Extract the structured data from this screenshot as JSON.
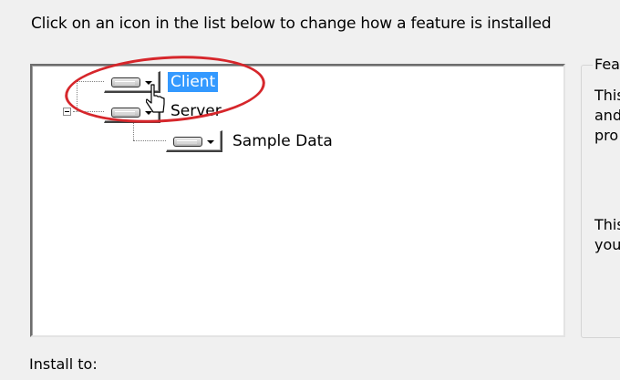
{
  "instruction": "Click on an icon in the list below to change how a feature is installed",
  "tree": {
    "items": [
      {
        "label": "Client",
        "icon": "hard-drive-icon",
        "selected": true
      },
      {
        "label": "Server",
        "icon": "hard-drive-icon",
        "selected": false,
        "expanded": true
      },
      {
        "label": "Sample Data",
        "icon": "hard-drive-icon",
        "selected": false
      }
    ]
  },
  "description_panel": {
    "title_fragment": "Fea",
    "lines_a": [
      "This",
      "and",
      "pro"
    ],
    "lines_b": [
      "This",
      "you"
    ]
  },
  "install_to": {
    "label": "Install to:"
  },
  "annotation": {
    "color": "#d6262b"
  },
  "colors": {
    "selection": "#3399ff"
  }
}
